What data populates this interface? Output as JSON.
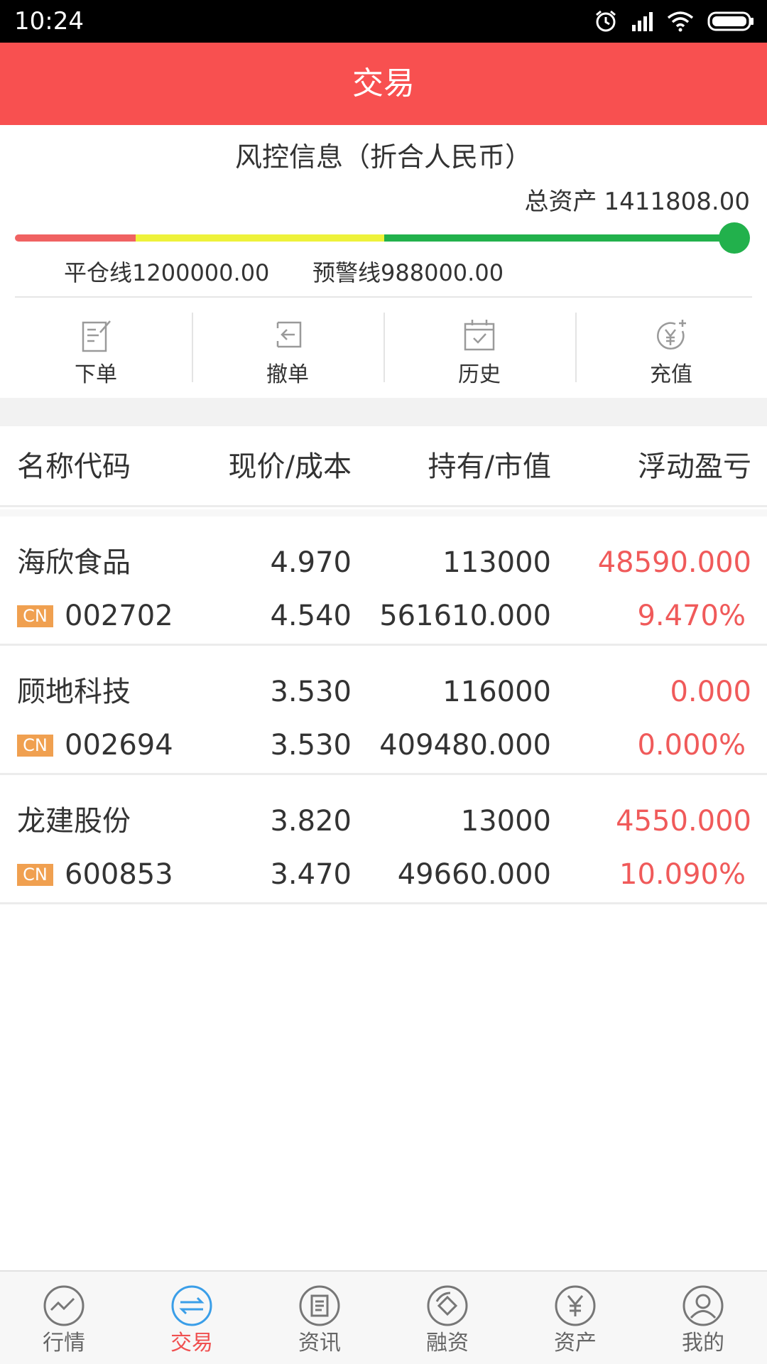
{
  "status_bar": {
    "time": "10:24"
  },
  "header": {
    "title": "交易"
  },
  "risk": {
    "title": "风控信息（折合人民币）",
    "total_assets_label": "总资产",
    "total_assets_value": "1411808.00",
    "close_line": "平仓线1200000.00",
    "warning_line": "预警线988000.00",
    "colors": {
      "danger": "#f06262",
      "warning": "#eef23a",
      "safe": "#22b14c"
    }
  },
  "actions": [
    {
      "label": "下单",
      "icon": "order-icon"
    },
    {
      "label": "撤单",
      "icon": "cancel-order-icon"
    },
    {
      "label": "历史",
      "icon": "calendar-history-icon"
    },
    {
      "label": "充值",
      "icon": "yuan-add-icon"
    }
  ],
  "table": {
    "headers": {
      "name": "名称代码",
      "price": "现价/成本",
      "holding": "持有/市值",
      "pl": "浮动盈亏"
    },
    "rows": [
      {
        "name": "海欣食品",
        "market": "CN",
        "code": "002702",
        "price": "4.970",
        "cost": "4.540",
        "holding": "113000",
        "market_value": "561610.000",
        "pl": "48590.000",
        "pl_pct": "9.470%"
      },
      {
        "name": "顾地科技",
        "market": "CN",
        "code": "002694",
        "price": "3.530",
        "cost": "3.530",
        "holding": "116000",
        "market_value": "409480.000",
        "pl": "0.000",
        "pl_pct": "0.000%"
      },
      {
        "name": "龙建股份",
        "market": "CN",
        "code": "600853",
        "price": "3.820",
        "cost": "3.470",
        "holding": "13000",
        "market_value": "49660.000",
        "pl": "4550.000",
        "pl_pct": "10.090%"
      }
    ]
  },
  "tabbar": {
    "items": [
      {
        "label": "行情",
        "icon": "market-chart-icon"
      },
      {
        "label": "交易",
        "icon": "exchange-arrows-icon",
        "active": true
      },
      {
        "label": "资讯",
        "icon": "news-icon"
      },
      {
        "label": "融资",
        "icon": "financing-icon"
      },
      {
        "label": "资产",
        "icon": "yuan-icon"
      },
      {
        "label": "我的",
        "icon": "profile-icon"
      }
    ],
    "active_color": "#f05050",
    "active_icon_color": "#3a9ee8"
  }
}
